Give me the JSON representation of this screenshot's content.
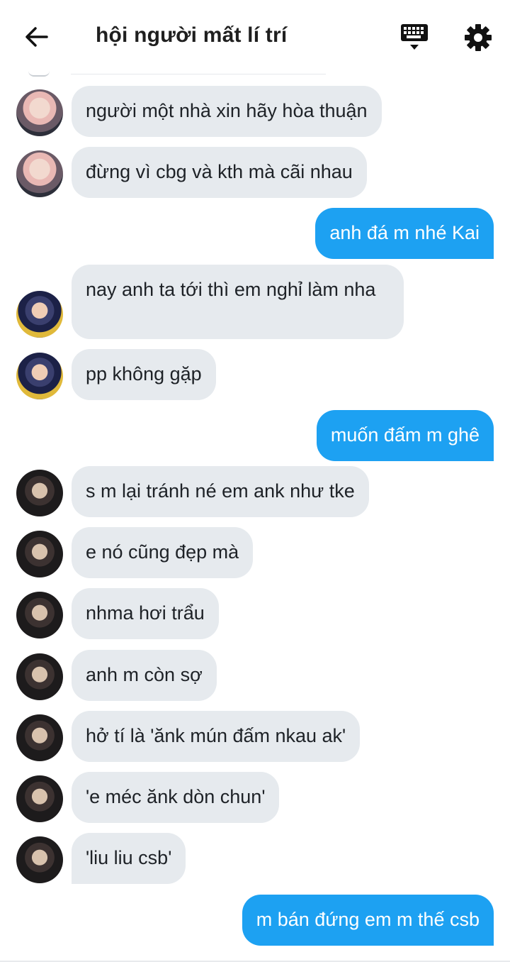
{
  "header": {
    "title": "hội người mất lí trí",
    "back_icon": "arrow-left-icon",
    "keyboard_icon": "keyboard-icon",
    "settings_icon": "gear-icon"
  },
  "colors": {
    "incoming_bubble": "#e6eaee",
    "outgoing_bubble": "#1da1f2",
    "text": "#1e2227"
  },
  "messages": [
    {
      "dir": "in",
      "text": "người một nhà xin hãy hòa thuận"
    },
    {
      "dir": "in",
      "text": "đừng vì cbg và kth mà cãi nhau"
    },
    {
      "dir": "out",
      "text": "anh đá m nhé Kai"
    },
    {
      "dir": "in",
      "text": "nay anh ta tới thì em nghỉ làm nha"
    },
    {
      "dir": "in",
      "text": "pp không gặp"
    },
    {
      "dir": "out",
      "text": "muốn đấm m ghê"
    },
    {
      "dir": "in",
      "text": "s m lại tránh né em ank như tke"
    },
    {
      "dir": "in",
      "text": "e nó cũng đẹp mà"
    },
    {
      "dir": "in",
      "text": "nhma hơi trẩu"
    },
    {
      "dir": "in",
      "text": "anh m còn sợ"
    },
    {
      "dir": "in",
      "text": "hở tí là 'ănk mún đấm nkau ak'"
    },
    {
      "dir": "in",
      "text": "'e méc ănk dòn chun'"
    },
    {
      "dir": "in",
      "text": "'liu liu csb'"
    },
    {
      "dir": "out",
      "text": "m bán đứng em m thế csb"
    }
  ]
}
